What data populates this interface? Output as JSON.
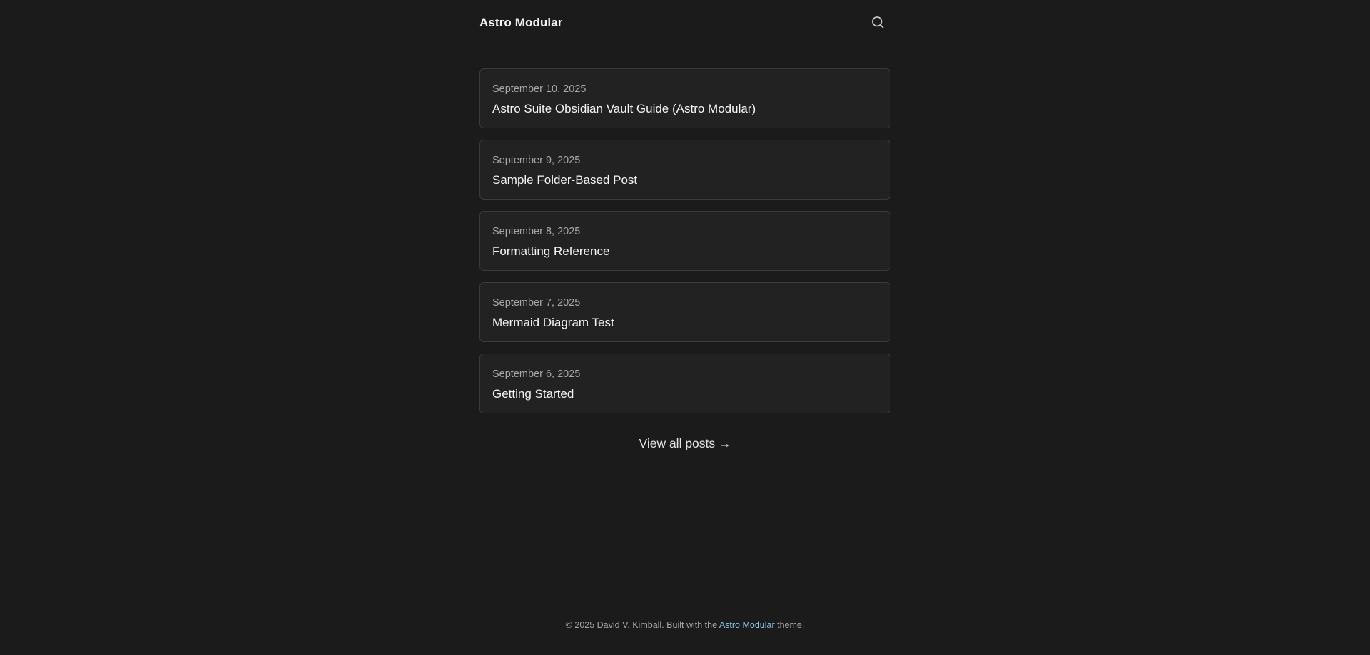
{
  "header": {
    "site_title": "Astro Modular",
    "search_icon": "search-icon"
  },
  "posts": [
    {
      "date": "September 10, 2025",
      "title": "Astro Suite Obsidian Vault Guide (Astro Modular)"
    },
    {
      "date": "September 9, 2025",
      "title": "Sample Folder-Based Post"
    },
    {
      "date": "September 8, 2025",
      "title": "Formatting Reference"
    },
    {
      "date": "September 7, 2025",
      "title": "Mermaid Diagram Test"
    },
    {
      "date": "September 6, 2025",
      "title": "Getting Started"
    }
  ],
  "view_all": {
    "label": "View all posts →"
  },
  "footer": {
    "prefix": "© 2025 David V. Kimball. Built with the ",
    "link_label": "Astro Modular",
    "suffix": " theme."
  },
  "colors": {
    "background": "#1b1b1b",
    "card_background": "#222222",
    "card_border": "#3a3a3a",
    "link_accent": "#8cc7e8"
  }
}
